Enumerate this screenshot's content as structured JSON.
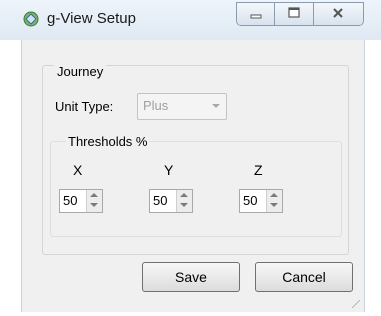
{
  "window": {
    "title": "g-View Setup",
    "caption_buttons": {
      "minimize_icon": "minimize-icon",
      "maximize_icon": "maximize-icon",
      "close_icon": "close-icon"
    }
  },
  "journey": {
    "group_label": "Journey",
    "unit_type": {
      "label": "Unit Type:",
      "value": "Plus"
    },
    "thresholds": {
      "label": "Thresholds %",
      "axes": [
        {
          "label": "X",
          "value": "50"
        },
        {
          "label": "Y",
          "value": "50"
        },
        {
          "label": "Z",
          "value": "50"
        }
      ]
    }
  },
  "buttons": {
    "save": "Save",
    "cancel": "Cancel"
  },
  "colors": {
    "titlebar": "#dfe9f3",
    "client_bg": "#f0f0f0",
    "disabled_text": "#a0a0a0"
  }
}
